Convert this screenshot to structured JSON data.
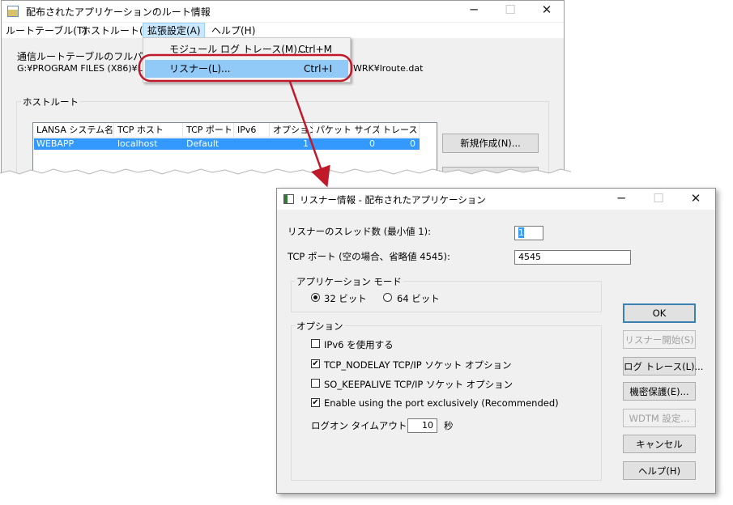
{
  "main_window": {
    "title": "配布されたアプリケーションのルート情報",
    "menu": [
      "ルートテーブル(T)",
      "ホストルート(R)",
      "拡張設定(A)",
      "ヘルプ(H)"
    ],
    "path_label": "通信ルートテーブルのフルパス:",
    "path_value_start": "G:¥PROGRAM FILES (X86)¥LANS",
    "path_value_end": "WRK¥lroute.dat",
    "group_title": "ホストルート",
    "list_headers": [
      "LANSA システム名",
      "TCP ホスト",
      "TCP ポート",
      "IPv6",
      "オプション",
      "パケット サイズ",
      "トレース"
    ],
    "list_row": [
      "WEBAPP",
      "localhost",
      "Default",
      "",
      "1",
      "0",
      "0"
    ],
    "new_button": "新規作成(N)..."
  },
  "dropdown": {
    "items": [
      {
        "label": "モジュール ログ トレース(M)...",
        "accel": "Ctrl+M"
      },
      {
        "label": "リスナー(L)...",
        "accel": "Ctrl+I"
      }
    ]
  },
  "dialog": {
    "title": "リスナー情報 - 配布されたアプリケーション",
    "threads_label": "リスナーのスレッド数 (最小値 1):",
    "threads_value": "1",
    "port_label": "TCP ポート (空の場合、省略値 4545):",
    "port_value": "4545",
    "mode_group": "アプリケーション モード",
    "mode_32": "32 ビット",
    "mode_64": "64 ビット",
    "mode_selected": "32",
    "options_group": "オプション",
    "options": [
      {
        "label": "IPv6 を使用する",
        "checked": false
      },
      {
        "label": "TCP_NODELAY TCP/IP ソケット オプション",
        "checked": true
      },
      {
        "label": "SO_KEEPALIVE TCP/IP ソケット オプション",
        "checked": false
      },
      {
        "label": "Enable using the port exclusively (Recommended)",
        "checked": true
      }
    ],
    "logon_label": "ログオン タイムアウト:",
    "logon_value": "10",
    "logon_unit": "秒",
    "buttons": {
      "ok": "OK",
      "start": "リスナー開始(S)",
      "log": "ログ トレース(L)...",
      "secure": "機密保護(E)...",
      "wdtm": "WDTM 設定...",
      "cancel": "キャンセル",
      "help": "ヘルプ(H)"
    }
  },
  "colors": {
    "selection": "#3399ff",
    "menu_highlight": "#91c9f7",
    "callout": "#c0192a"
  }
}
